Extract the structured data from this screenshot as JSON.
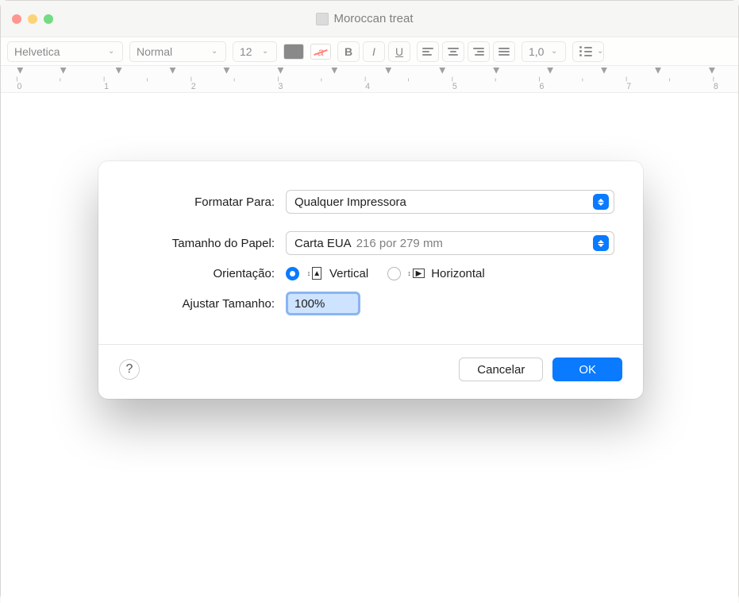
{
  "window": {
    "title": "Moroccan treat"
  },
  "toolbar": {
    "font": "Helvetica",
    "style": "Normal",
    "size": "12",
    "spacing": "1,0"
  },
  "modal": {
    "labels": {
      "format_for": "Formatar Para:",
      "paper_size": "Tamanho do Papel:",
      "orientation": "Orientação:",
      "scale": "Ajustar Tamanho:"
    },
    "format_for_value": "Qualquer Impressora",
    "paper_size_value": "Carta EUA",
    "paper_size_detail": "216 por 279 mm",
    "orientation_portrait": "Vertical",
    "orientation_landscape": "Horizontal",
    "orientation_selected": "portrait",
    "scale_value": "100%",
    "buttons": {
      "cancel": "Cancelar",
      "ok": "OK",
      "help": "?"
    }
  }
}
